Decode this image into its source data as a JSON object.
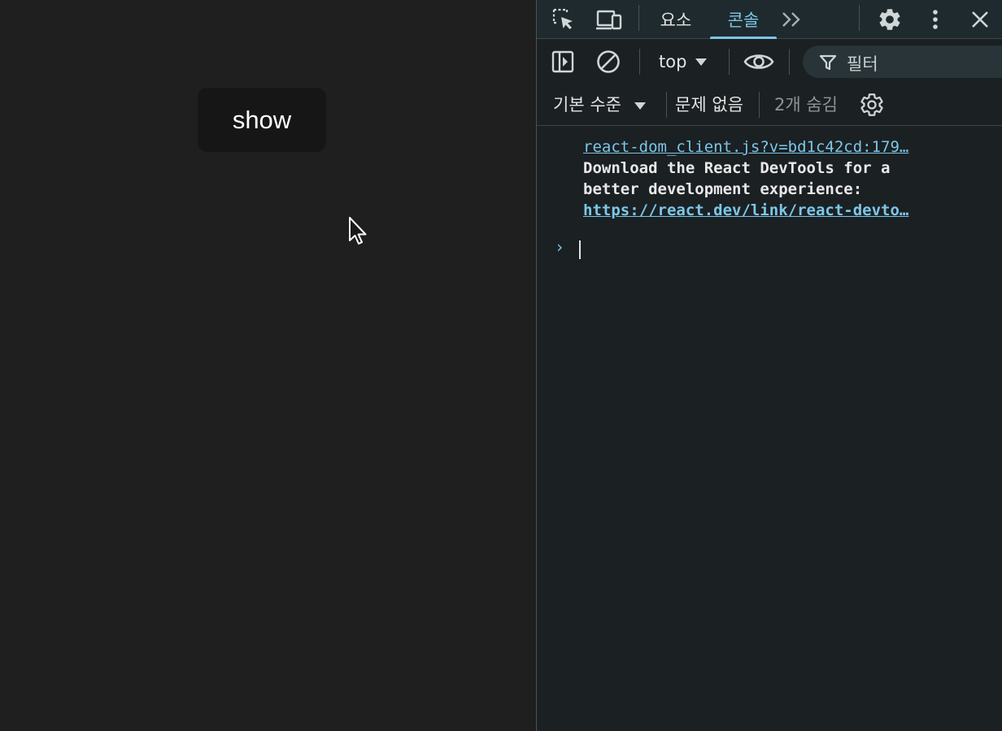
{
  "page": {
    "button_label": "show"
  },
  "devtools": {
    "tabs": [
      {
        "label": "요소",
        "active": false
      },
      {
        "label": "콘솔",
        "active": true
      }
    ],
    "toolbar": {
      "context": "top",
      "filter_placeholder": "필터",
      "log_level": "기본 수준",
      "issues": "문제 없음",
      "hidden_count": "2개 숨김"
    },
    "console": {
      "message": {
        "source": "react-dom_client.js?v=bd1c42cd:179…",
        "text_line1": "Download the React DevTools for a",
        "text_line2": "better development experience:",
        "url": "https://react.dev/link/react-devto…"
      },
      "prompt": "›"
    }
  },
  "colors": {
    "page_bg": "#1f1f1f",
    "devtools_bg": "#1b2023",
    "accent": "#7cc7e8"
  },
  "icons": [
    "inspect-element-icon",
    "device-toolbar-icon",
    "more-tabs-icon",
    "settings-icon",
    "kebab-menu-icon",
    "close-icon",
    "sidebar-toggle-icon",
    "clear-console-icon",
    "dropdown-arrow-icon",
    "live-expression-eye-icon",
    "filter-icon",
    "console-settings-icon",
    "mouse-cursor-icon"
  ]
}
